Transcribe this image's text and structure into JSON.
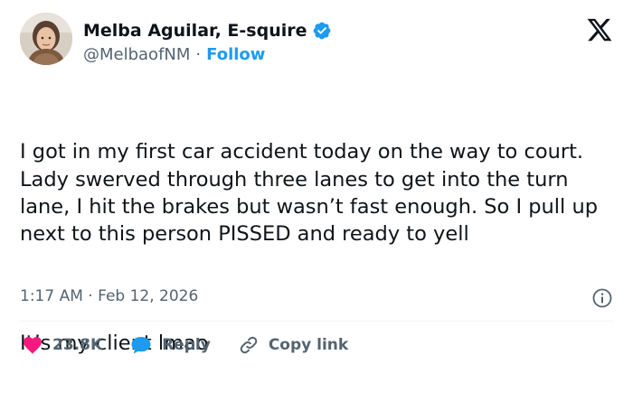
{
  "author": {
    "display_name": "Melba Aguilar, E-squire",
    "handle": "@MelbaofNM",
    "separator": "·",
    "follow_label": "Follow"
  },
  "tweet": {
    "paragraph_1": "I got in my first car accident today on the way to court. Lady swerved through three lanes to get into the turn lane, I hit the brakes but wasn’t fast enough. So I pull up next to this person PISSED and ready to yell",
    "paragraph_2": "It’s my client lmao"
  },
  "meta": {
    "time": "1:17 AM",
    "separator": "·",
    "date": "Feb 12, 2026"
  },
  "actions": {
    "like_count": "23.8K",
    "reply_label": "Reply",
    "copy_link_label": "Copy link"
  },
  "icons": {
    "verified": "verified-badge-icon",
    "logo": "x-logo-icon",
    "info": "info-icon",
    "like": "heart-icon",
    "reply": "speech-bubble-icon",
    "copy_link": "link-icon"
  },
  "colors": {
    "accent": "#1d9bf0",
    "like": "#f91880",
    "text": "#0f1419",
    "secondary": "#536471"
  }
}
